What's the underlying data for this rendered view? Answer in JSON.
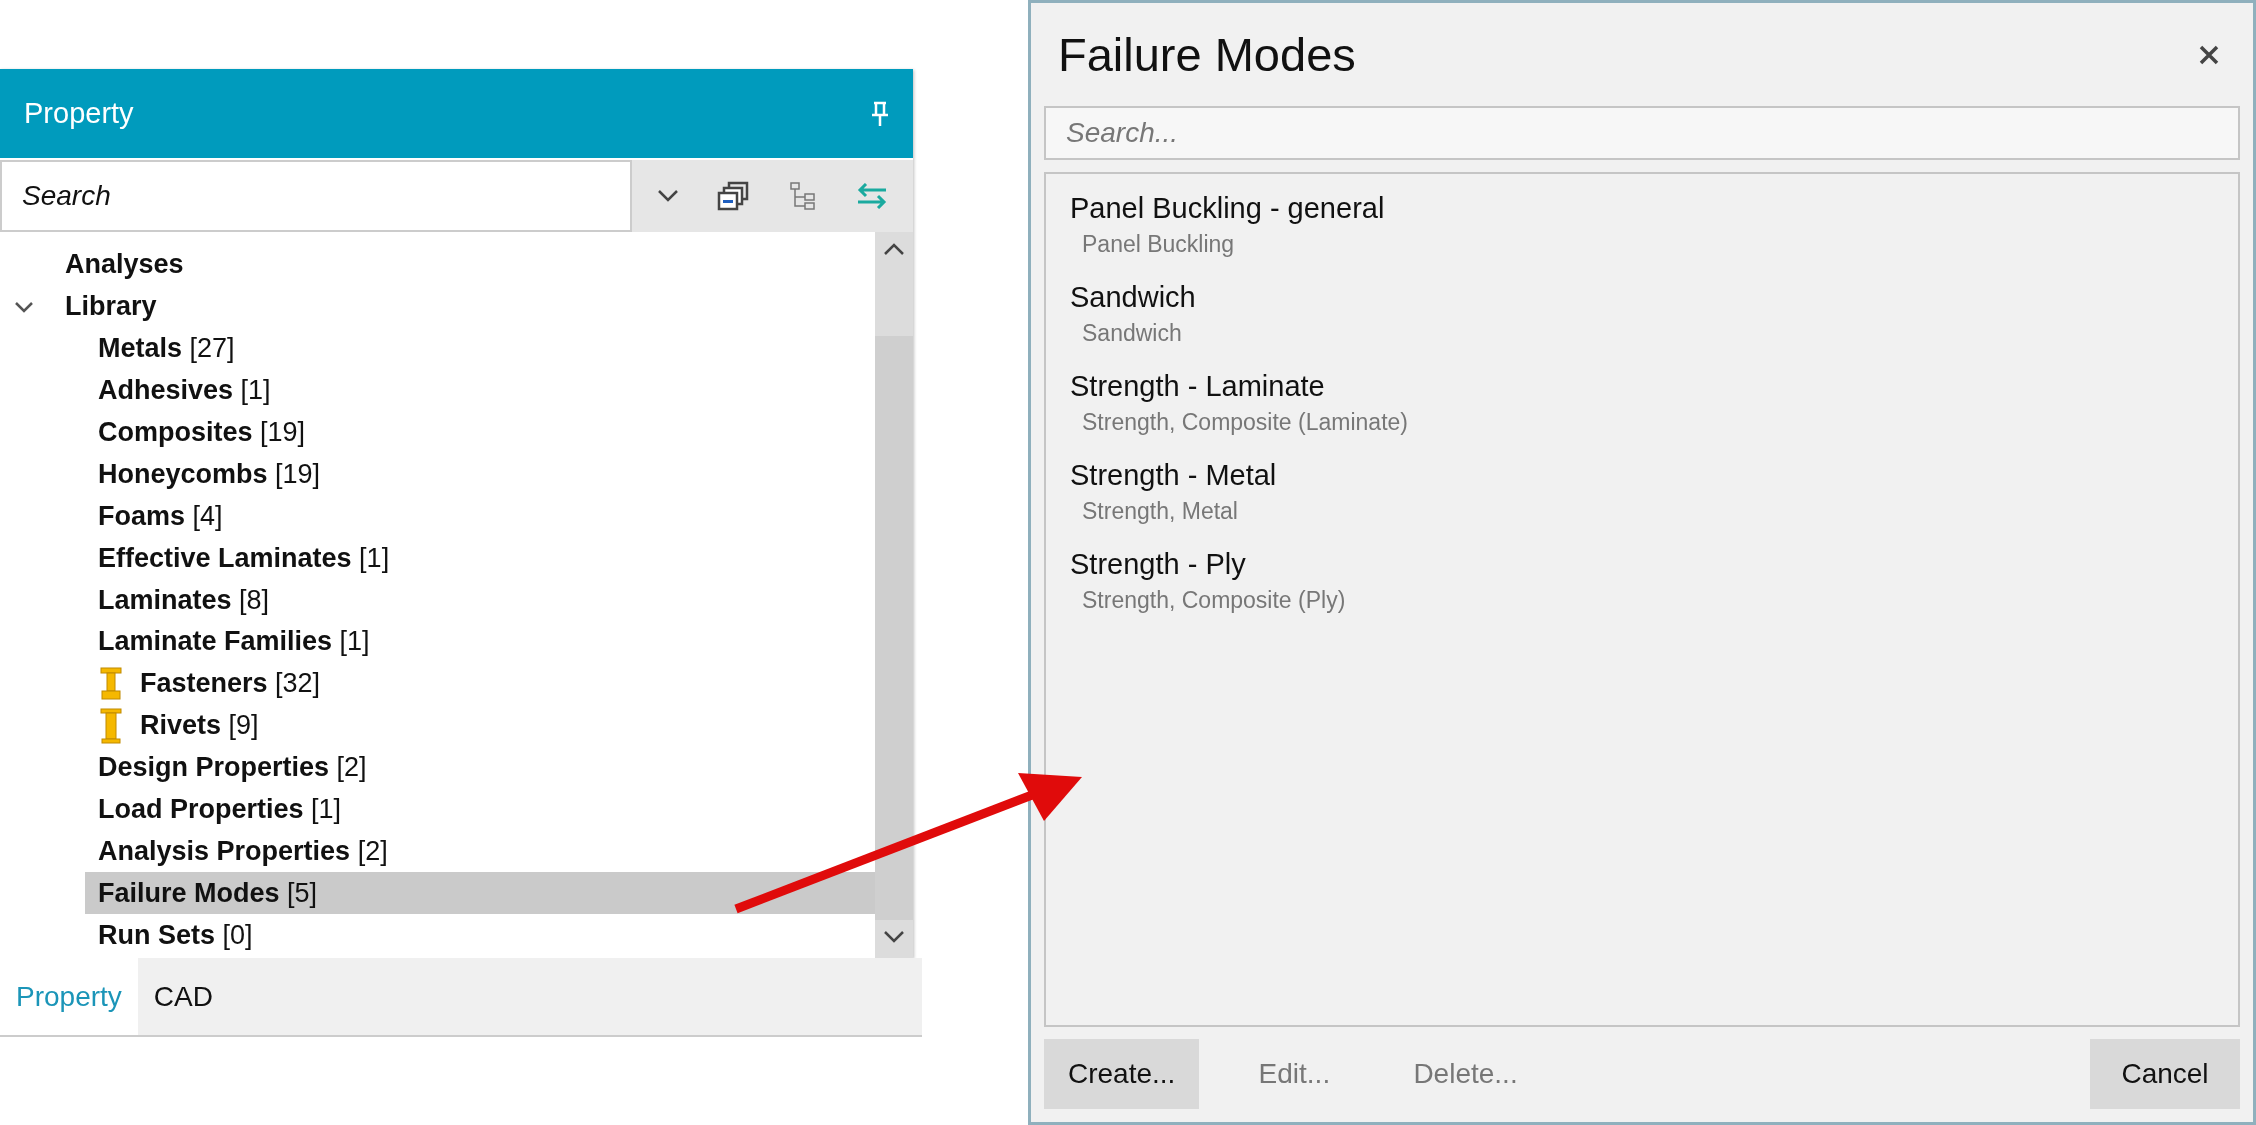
{
  "property_panel": {
    "title": "Property",
    "search": {
      "placeholder": "Search"
    },
    "tree": [
      {
        "label": "Analyses"
      },
      {
        "label": "Library",
        "expanded": true,
        "children": [
          {
            "label": "**Metals** [27]",
            "selected": false
          },
          {
            "label": "**Adhesives** [1]",
            "selected": false
          },
          {
            "label": "**Composites** [19]",
            "selected": false
          },
          {
            "label": "**Honeycombs** [19]",
            "selected": false
          },
          {
            "label": "**Foams** [4]",
            "selected": false
          },
          {
            "label": "**Effective Laminates** [1]",
            "selected": false
          },
          {
            "label": "**Laminates** [8]",
            "selected": false
          },
          {
            "label": "**Laminate Families** [1]",
            "selected": false
          },
          {
            "label": "**Fasteners** [32]",
            "selected": false,
            "kind": "bolt"
          },
          {
            "label": "**Rivets** [9]",
            "selected": false,
            "kind": "rivet"
          },
          {
            "label": "**Design Properties** [2]",
            "selected": false
          },
          {
            "label": "**Load Properties** [1]",
            "selected": false
          },
          {
            "label": "**Analysis Properties** [2]",
            "selected": false
          },
          {
            "label": "**Failure Modes** [5]",
            "selected": true
          },
          {
            "label": "**Run Sets** [0]",
            "selected": false
          }
        ]
      }
    ],
    "tabs": [
      {
        "label": "Property",
        "selected": true
      },
      {
        "label": "CAD",
        "selected": false
      }
    ]
  },
  "failure_modes_dialog": {
    "title": "Failure Modes",
    "search": {
      "placeholder": "Search..."
    },
    "items": [
      {
        "name": "Panel Buckling - general",
        "type": "Panel Buckling"
      },
      {
        "name": "Sandwich",
        "type": "Sandwich"
      },
      {
        "name": "Strength - Laminate",
        "type": "Strength, Composite (Laminate)"
      },
      {
        "name": "Strength - Metal",
        "type": "Strength, Metal"
      },
      {
        "name": "Strength - Ply",
        "type": "Strength, Composite (Ply)"
      }
    ],
    "buttons": [
      {
        "label": "Create...",
        "disabled": false
      },
      {
        "label": "Edit...",
        "disabled": true
      },
      {
        "label": "Delete...",
        "disabled": true
      }
    ],
    "cancel_button": {
      "label": "Cancel"
    }
  }
}
